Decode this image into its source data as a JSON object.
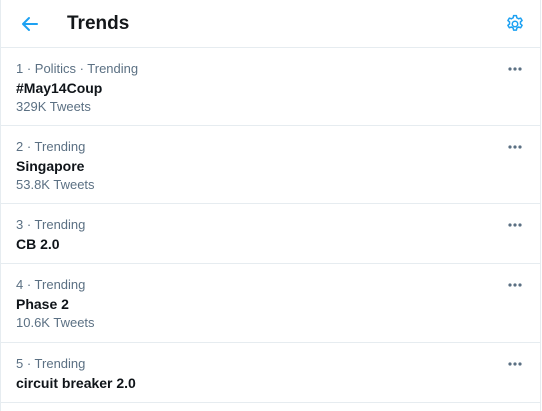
{
  "header": {
    "title": "Trends",
    "back_icon": "arrow-left-icon",
    "settings_icon": "gear-icon",
    "accent_color": "#1da1f2"
  },
  "trends": [
    {
      "meta": "1 · Politics · Trending",
      "name": "#May14Coup",
      "count": "329K Tweets"
    },
    {
      "meta": "2 · Trending",
      "name": "Singapore",
      "count": "53.8K Tweets"
    },
    {
      "meta": "3 · Trending",
      "name": "CB 2.0",
      "count": ""
    },
    {
      "meta": "4 · Trending",
      "name": "Phase 2",
      "count": "10.6K Tweets"
    },
    {
      "meta": "5 · Trending",
      "name": "circuit breaker 2.0",
      "count": ""
    }
  ],
  "more_icon": "more-dots-icon"
}
